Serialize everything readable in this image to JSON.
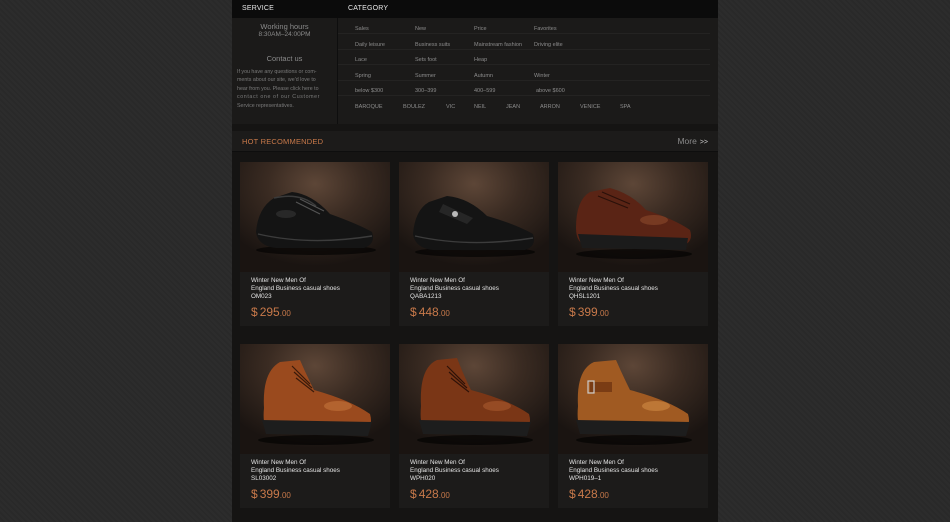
{
  "topbar": {
    "service_title": "SERVICE",
    "category_title": "CATEGORY"
  },
  "service": {
    "hours_label": "Working hours",
    "hours_value": "8:30AM–24:00PM",
    "contact_label": "Contact us",
    "contact_lines": [
      "If you have any questions or com-",
      "ments about our site, we'd love to",
      "hear from you. Please click here to",
      "contact one of our Customer",
      "Service representatives."
    ]
  },
  "categories": [
    [
      "Sales",
      "New",
      "Price",
      "Favorites"
    ],
    [
      "Daily leisure",
      "Business suits",
      "Mainstream fashion",
      "Driving elite"
    ],
    [
      "Lace",
      "Sets foot",
      "Heap"
    ],
    [
      "Spring",
      "Summer",
      "Autumn",
      "Winter"
    ],
    [
      "below $300",
      "300–399",
      "400–599",
      "above $600"
    ],
    [
      "BAROQUE",
      "BOULEZ",
      "VIC",
      "NEIL",
      "JEAN",
      "ARRON",
      "VENICE",
      "SPA"
    ]
  ],
  "hot": {
    "title": "HOT RECOMMENDED",
    "more": "More",
    "more_arrow": ">>"
  },
  "products": [
    {
      "line1": "Winter New Men Of",
      "line2": "England Business casual shoes",
      "code": "OM023",
      "currency": "$",
      "price_int": "295",
      "price_dec": ".00",
      "icon": "black-lace-up-shoe-icon",
      "color": "#151515"
    },
    {
      "line1": "Winter New Men Of",
      "line2": "England Business casual shoes",
      "code": "QABA1213",
      "currency": "$",
      "price_int": "448",
      "price_dec": ".00",
      "icon": "black-strap-shoe-icon",
      "color": "#151515"
    },
    {
      "line1": "Winter New Men Of",
      "line2": "England Business casual shoes",
      "code": "QHSL1201",
      "currency": "$",
      "price_int": "399",
      "price_dec": ".00",
      "icon": "brown-derby-shoe-icon",
      "color": "#5a2415"
    },
    {
      "line1": "Winter New Men Of",
      "line2": "England Business casual shoes",
      "code": "SL03002",
      "currency": "$",
      "price_int": "399",
      "price_dec": ".00",
      "icon": "tan-lace-up-boot-icon",
      "color": "#9a4a1e"
    },
    {
      "line1": "Winter New Men Of",
      "line2": "England Business casual shoes",
      "code": "WPH020",
      "currency": "$",
      "price_int": "428",
      "price_dec": ".00",
      "icon": "brown-lace-up-boot-icon",
      "color": "#7a3616"
    },
    {
      "line1": "Winter New Men Of",
      "line2": "England Business casual shoes",
      "code": "WPH019–1",
      "currency": "$",
      "price_int": "428",
      "price_dec": ".00",
      "icon": "tan-buckle-boot-icon",
      "color": "#a05a22"
    }
  ]
}
